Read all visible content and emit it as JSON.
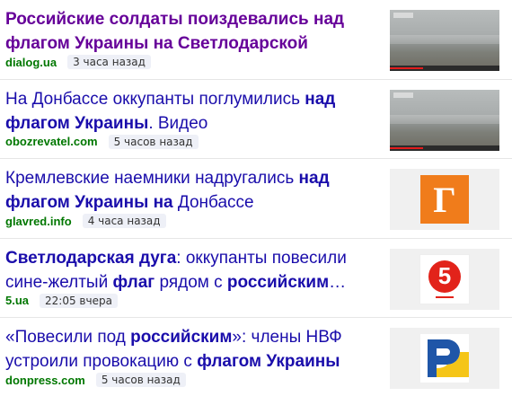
{
  "news": [
    {
      "title_parts": [
        {
          "text": "Российские солдаты поиздевались над флагом Украины на Светлодарской дуге:…",
          "bold": true
        }
      ],
      "visited": true,
      "source": "dialog.ua",
      "time": "3 часа назад",
      "thumbnail": "video-still"
    },
    {
      "title_parts": [
        {
          "text": "На Донбассе оккупанты поглумились ",
          "bold": false
        },
        {
          "text": "над флагом Украины",
          "bold": true
        },
        {
          "text": ". Видео",
          "bold": false
        }
      ],
      "visited": false,
      "source": "obozrevatel.com",
      "time": "5 часов назад",
      "thumbnail": "video-still"
    },
    {
      "title_parts": [
        {
          "text": "Кремлевские наемники надругались ",
          "bold": false
        },
        {
          "text": "над флагом Украины на",
          "bold": true
        },
        {
          "text": " Донбассе",
          "bold": false
        }
      ],
      "visited": false,
      "source": "glavred.info",
      "time": "4 часа назад",
      "thumbnail": "glavred-logo",
      "logo_letter": "Г",
      "logo_color": "#f07c1b"
    },
    {
      "title_parts": [
        {
          "text": "Светлодарская дуга",
          "bold": true
        },
        {
          "text": ": оккупанты повесили сине-желтый ",
          "bold": false
        },
        {
          "text": "флаг",
          "bold": true
        },
        {
          "text": " рядом с ",
          "bold": false
        },
        {
          "text": "российским",
          "bold": true
        },
        {
          "text": "…",
          "bold": false
        }
      ],
      "visited": false,
      "source": "5.ua",
      "time": "22:05 вчера",
      "thumbnail": "channel5-logo",
      "logo_letter": "5",
      "logo_color": "#e2231a"
    },
    {
      "title_parts": [
        {
          "text": "«Повесили под ",
          "bold": false
        },
        {
          "text": "российским",
          "bold": true
        },
        {
          "text": "»: члены НВФ устроили провокацию с ",
          "bold": false
        },
        {
          "text": "флагом Украины",
          "bold": true
        }
      ],
      "visited": false,
      "source": "donpress.com",
      "time": "5 часов назад",
      "thumbnail": "donpress-logo",
      "logo_letter": "P",
      "logo_colors": [
        "#1f56a8",
        "#f5c518"
      ]
    }
  ],
  "colors": {
    "link": "#1a0dab",
    "visited": "#660099",
    "source": "#007700"
  }
}
